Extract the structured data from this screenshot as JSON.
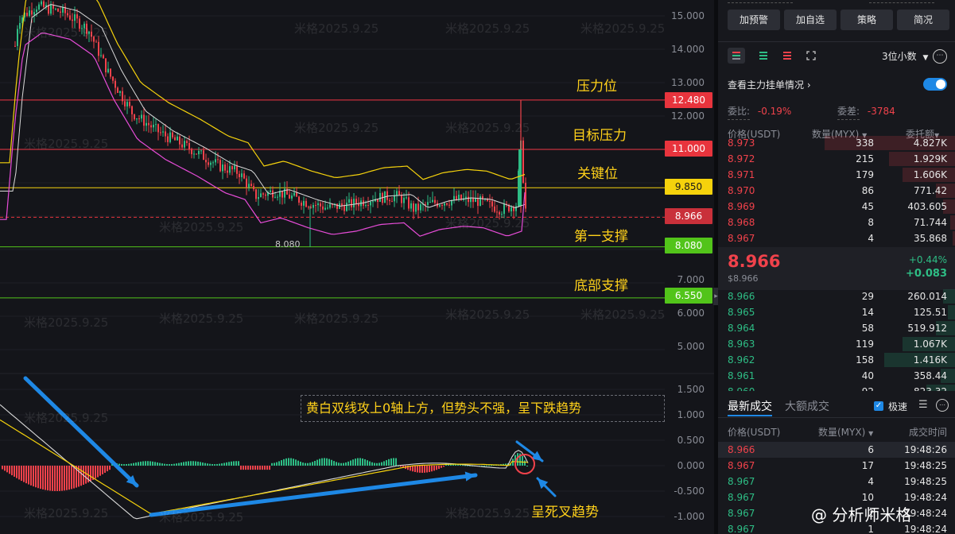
{
  "watermark": "米格2025.9.25",
  "price_axis": [
    "15.000",
    "14.000",
    "13.000",
    "12.000",
    "7.000",
    "6.000",
    "5.000"
  ],
  "macd_axis": [
    "1.500",
    "1.000",
    "0.500",
    "0.000",
    "-0.500",
    "-1.000"
  ],
  "levels": [
    {
      "key": "resistance",
      "price": 12.48,
      "label": "12.480",
      "annotation": "压力位",
      "line_color": "#f23645",
      "box_color": "#e8343d",
      "text_color": "#ffffff"
    },
    {
      "key": "target",
      "price": 11.0,
      "label": "11.000",
      "annotation": "目标压力",
      "line_color": "#f23645",
      "box_color": "#e8343d",
      "text_color": "#ffffff"
    },
    {
      "key": "key",
      "price": 9.85,
      "label": "9.850",
      "annotation": "关键位",
      "line_color": "#f5d20c",
      "box_color": "#f5d20c",
      "text_color": "#1a1a1a"
    },
    {
      "key": "current",
      "price": 8.966,
      "label": "8.966",
      "annotation": "",
      "line_color": "#e8343d",
      "box_color": "#c9303a",
      "text_color": "#ffffff"
    },
    {
      "key": "support1",
      "price": 8.08,
      "label": "8.080",
      "annotation": "第一支撑",
      "line_color": "#52c41a",
      "box_color": "#52c41a",
      "text_color": "#ffffff"
    },
    {
      "key": "support_bottom",
      "price": 6.55,
      "label": "6.550",
      "annotation": "底部支撑",
      "line_color": "#52c41a",
      "box_color": "#52c41a",
      "text_color": "#ffffff"
    }
  ],
  "low_marker": "8.080",
  "macd_note": "黄白双线攻上0轴上方，但势头不强，呈下跌趋势",
  "death_cross_note": "呈死叉趋势",
  "panel": {
    "buttons": [
      "加预警",
      "加自选",
      "策略",
      "简况"
    ],
    "decimal_select": "3位小数",
    "main_orders_label": "查看主力挂单情况",
    "main_orders_toggle_on": true,
    "ratio_label": "委比:",
    "ratio_value": "-0.19%",
    "diff_label": "委差:",
    "diff_value": "-3784",
    "headers": {
      "price": "价格(USDT)",
      "qty": "数量(MYX)",
      "amount": "委托额"
    },
    "asks": [
      {
        "price": "8.973",
        "qty": "338",
        "amount": "4.827K",
        "depth": 0.55
      },
      {
        "price": "8.972",
        "qty": "215",
        "amount": "1.929K",
        "depth": 0.28
      },
      {
        "price": "8.971",
        "qty": "179",
        "amount": "1.606K",
        "depth": 0.22
      },
      {
        "price": "8.970",
        "qty": "86",
        "amount": "771.42",
        "depth": 0.08
      },
      {
        "price": "8.969",
        "qty": "45",
        "amount": "403.605",
        "depth": 0.05
      },
      {
        "price": "8.968",
        "qty": "8",
        "amount": "71.744",
        "depth": 0.02
      },
      {
        "price": "8.967",
        "qty": "4",
        "amount": "35.868",
        "depth": 0.01
      }
    ],
    "last_price": "8.966",
    "last_price_usd": "$8.966",
    "change_pct": "+0.44%",
    "change_abs": "+0.083",
    "bids": [
      {
        "price": "8.966",
        "qty": "29",
        "amount": "260.014",
        "depth": 0.05
      },
      {
        "price": "8.965",
        "qty": "14",
        "amount": "125.51",
        "depth": 0.03
      },
      {
        "price": "8.964",
        "qty": "58",
        "amount": "519.912",
        "depth": 0.08
      },
      {
        "price": "8.963",
        "qty": "119",
        "amount": "1.067K",
        "depth": 0.22
      },
      {
        "price": "8.962",
        "qty": "158",
        "amount": "1.416K",
        "depth": 0.3
      },
      {
        "price": "8.961",
        "qty": "40",
        "amount": "358.44",
        "depth": 0.06
      },
      {
        "price": "8.960",
        "qty": "92",
        "amount": "823.32",
        "depth": 0.12
      }
    ],
    "trades_tab_active": "最新成交",
    "trades_tab_other": "大额成交",
    "fast_label": "极速",
    "trade_headers": {
      "price": "价格(USDT)",
      "qty": "数量(MYX)",
      "time": "成交时间"
    },
    "trades": [
      {
        "price": "8.966",
        "side": "sell",
        "qty": "6",
        "time": "19:48:26"
      },
      {
        "price": "8.967",
        "side": "sell",
        "qty": "17",
        "time": "19:48:25"
      },
      {
        "price": "8.967",
        "side": "buy",
        "qty": "4",
        "time": "19:48:25"
      },
      {
        "price": "8.967",
        "side": "buy",
        "qty": "10",
        "time": "19:48:24"
      },
      {
        "price": "8.967",
        "side": "buy",
        "qty": "2",
        "time": "19:48:24"
      },
      {
        "price": "8.967",
        "side": "buy",
        "qty": "1",
        "time": "19:48:24"
      }
    ]
  },
  "footer_mark": "@ 分析师米格",
  "colors": {
    "up": "#2ebd85",
    "down": "#f0424b",
    "accent": "#1e88e5",
    "yellow_line": "#f5d20c",
    "white_line": "#d9d9d9",
    "pink_line": "#e74cd8"
  }
}
